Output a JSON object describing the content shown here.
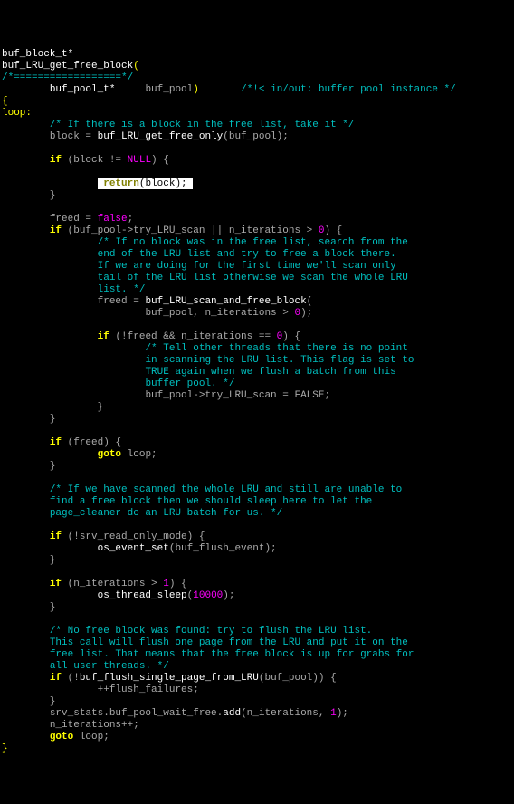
{
  "code": {
    "ret_type": "buf_block_t*",
    "fn_name": "buf_LRU_get_free_block",
    "hr1": "/*==================*/",
    "param_type": "buf_pool_t*",
    "param_name": "buf_pool",
    "param_comment": "/*!< in/out: buffer pool instance */",
    "label": "loop:",
    "c1": "/* If there is a block in the free list, take it */",
    "s1a": "block = ",
    "s1b": "buf_LRU_get_free_only",
    "s1c": "(buf_pool);",
    "s2a": "(block != ",
    "s2b": ") {",
    "ret_kw": "return",
    "ret_arg": "(block);",
    "close1": "}",
    "s3a": "freed = ",
    "false": "false",
    "semi": ";",
    "s4a": "(buf_pool->try_LRU_scan || n_iterations > ",
    "zero": "0",
    "s4b": ") {",
    "c2a": "/* If no block was in the free list, search from the",
    "c2b": "end of the LRU list and try to free a block there.",
    "c2c": "If we are doing for the first time we'll scan only",
    "c2d": "tail of the LRU list otherwise we scan the whole LRU",
    "c2e": "list. */",
    "s5a": "freed = ",
    "s5b": "buf_LRU_scan_and_free_block",
    "s5c": "(",
    "s5d": "buf_pool, n_iterations > ",
    "s5e": ");",
    "s6a": "(!freed && n_iterations == ",
    "s6b": ") {",
    "c3a": "/* Tell other threads that there is no point",
    "c3b": "in scanning the LRU list. This flag is set to",
    "c3c": "TRUE again when we flush a batch from this",
    "c3d": "buffer pool. */",
    "s7": "buf_pool->try_LRU_scan = FALSE;",
    "close2": "}",
    "close3": "}",
    "s8a": "(freed) {",
    "goto": "goto",
    "loopref": "loop",
    "close4": "}",
    "c4a": "/* If we have scanned the whole LRU and still are unable to",
    "c4b": "find a free block then we should sleep here to let the",
    "c4c": "page_cleaner do an LRU batch for us. */",
    "s9a": "(!srv_read_only_mode) {",
    "s9b": "os_event_set",
    "s9c": "(buf_flush_event);",
    "close5": "}",
    "s10a": "(n_iterations > ",
    "one": "1",
    "s10b": ") {",
    "s10c": "os_thread_sleep",
    "s10d": "(",
    "tenk": "10000",
    "s10e": ");",
    "close6": "}",
    "c5a": "/* No free block was found: try to flush the LRU list.",
    "c5b": "This call will flush one page from the LRU and put it on the",
    "c5c": "free list. That means that the free block is up for grabs for",
    "c5d": "all user threads. */",
    "s11a": "(!",
    "s11b": "buf_flush_single_page_from_LRU",
    "s11c": "(buf_pool)) {",
    "s11d": "++flush_failures;",
    "close7": "}",
    "s12a": "srv_stats.buf_pool_wait_free.",
    "s12b": "add",
    "s12c": "(n_iterations, ",
    "s12d": ");",
    "s13": "n_iterations++;",
    "close8": "}",
    "if": "if",
    "null": "NULL"
  }
}
